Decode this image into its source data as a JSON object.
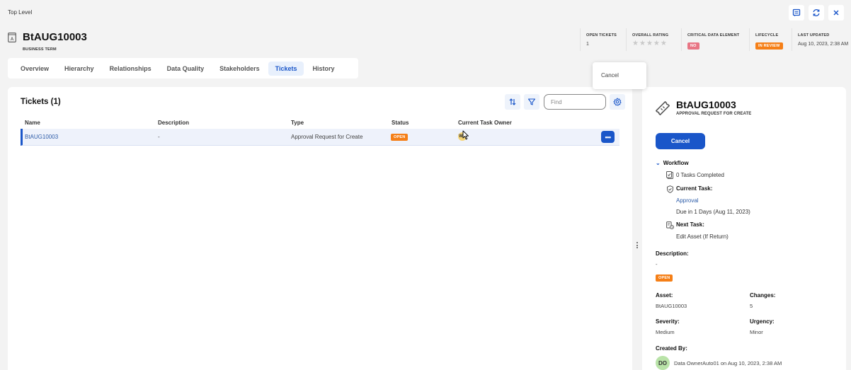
{
  "breadcrumb": "Top Level",
  "window_actions": [
    {
      "name": "comment-icon",
      "label": "Comments"
    },
    {
      "name": "refresh-icon",
      "label": "Refresh"
    },
    {
      "name": "close-icon",
      "label": "Close"
    }
  ],
  "asset": {
    "icon": "business-term-icon",
    "title": "BtAUG10003",
    "type": "BUSINESS TERM"
  },
  "meta": {
    "open_tickets": {
      "label": "OPEN TICKETS",
      "value": "1"
    },
    "overall_rating": {
      "label": "OVERALL RATING",
      "stars": 0,
      "max": 5
    },
    "critical_data_element": {
      "label": "CRITICAL DATA ELEMENT",
      "value": "NO"
    },
    "lifecycle": {
      "label": "LIFECYCLE",
      "value": "IN REVIEW"
    },
    "last_updated": {
      "label": "LAST UPDATED",
      "value": "Aug 10, 2023, 2:38 AM"
    }
  },
  "tabs": [
    {
      "label": "Overview",
      "active": false
    },
    {
      "label": "Hierarchy",
      "active": false
    },
    {
      "label": "Relationships",
      "active": false
    },
    {
      "label": "Data Quality",
      "active": false
    },
    {
      "label": "Stakeholders",
      "active": false
    },
    {
      "label": "Tickets",
      "active": true
    },
    {
      "label": "History",
      "active": false
    }
  ],
  "tickets": {
    "title": "Tickets (1)",
    "find_placeholder": "Find",
    "columns": [
      "Name",
      "Description",
      "Type",
      "Status",
      "Current Task Owner"
    ],
    "rows": [
      {
        "name": "BtAUG10003",
        "description": "-",
        "type": "Approval Request for Create",
        "status": "OPEN",
        "owner_initials": "WA"
      }
    ],
    "row_menu": [
      "Cancel"
    ]
  },
  "detail": {
    "title": "BtAUG10003",
    "subtitle": "APPROVAL REQUEST FOR CREATE",
    "cancel_label": "Cancel",
    "workflow": {
      "label": "Workflow",
      "tasks_completed": "0 Tasks Completed",
      "current_task_label": "Current Task:",
      "current_task": "Approval",
      "due": "Due in 1 Days (Aug 11, 2023)",
      "next_task_label": "Next Task:",
      "next_task": "Edit Asset (If Return)"
    },
    "description_label": "Description:",
    "description": "-",
    "status": "OPEN",
    "asset_label": "Asset:",
    "asset": "BtAUG10003",
    "changes_label": "Changes:",
    "changes": "5",
    "severity_label": "Severity:",
    "severity": "Medium",
    "urgency_label": "Urgency:",
    "urgency": "Minor",
    "created_by_label": "Created By:",
    "created_by_initials": "DO",
    "created_by": "Data OwnerAuto01 on Aug 10, 2023, 2:38 AM"
  },
  "colors": {
    "accent": "#1a56c9",
    "open_badge": "#f57f17",
    "in_review_badge": "#f57f17",
    "no_badge": "#e87584",
    "owner_avatar": "#f4d477",
    "creator_avatar": "#b9e3a8"
  }
}
